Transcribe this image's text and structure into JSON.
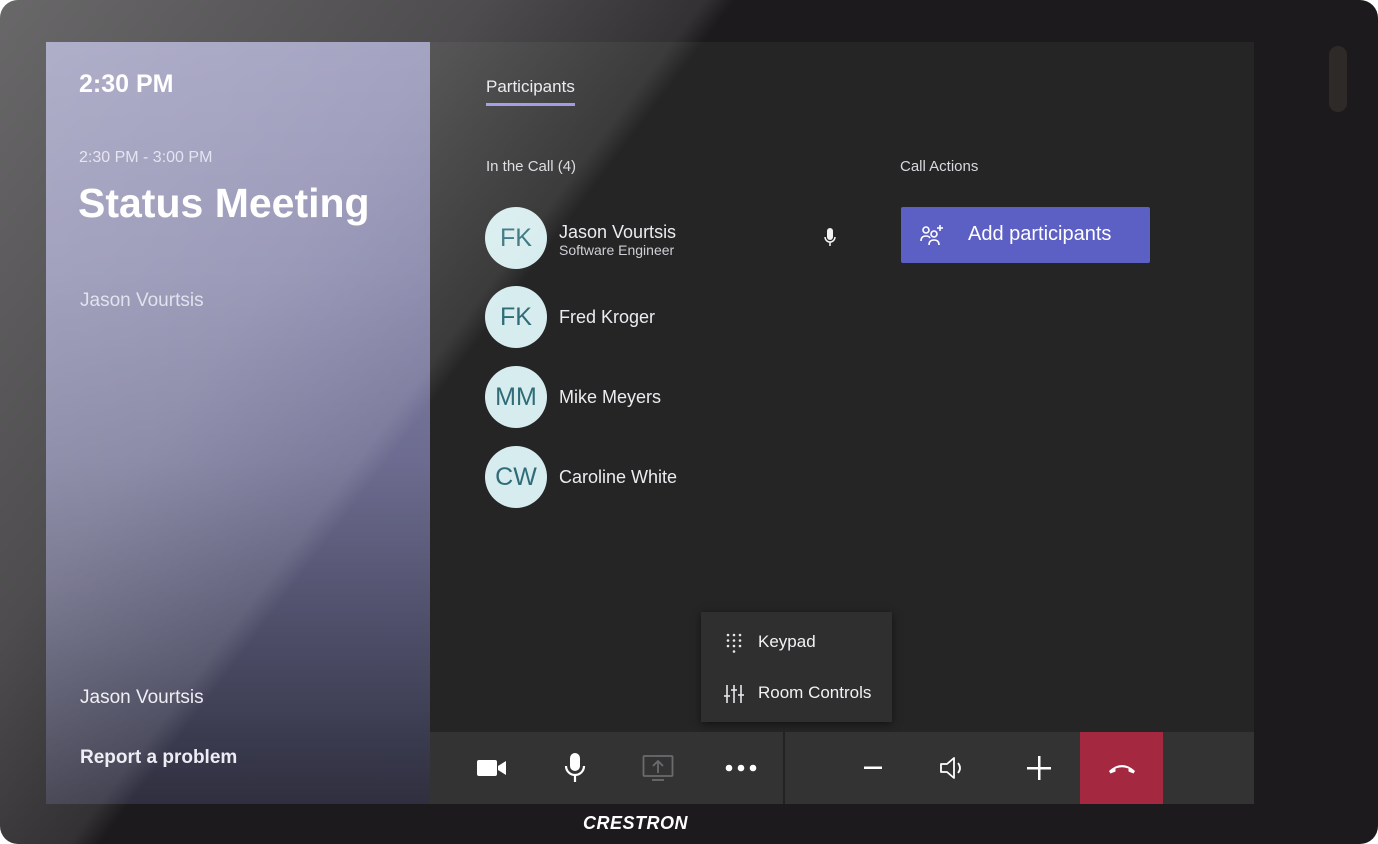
{
  "sidebar": {
    "time": "2:30 PM",
    "meeting_range": "2:30 PM - 3:00 PM",
    "meeting_title": "Status Meeting",
    "organizer": "Jason Vourtsis",
    "signed_in_user": "Jason Vourtsis",
    "report_problem": "Report a problem"
  },
  "main": {
    "tab_label": "Participants",
    "in_call_label": "In the Call (4)",
    "call_actions_label": "Call Actions",
    "participants": [
      {
        "initials": "FK",
        "name": "Jason Vourtsis",
        "role": "Software Engineer"
      },
      {
        "initials": "FK",
        "name": "Fred Kroger"
      },
      {
        "initials": "MM",
        "name": "Mike Meyers"
      },
      {
        "initials": "CW",
        "name": "Caroline White"
      }
    ],
    "add_participants_label": "Add participants",
    "accent_color": "#5c5fc4"
  },
  "more_menu": {
    "keypad_label": "Keypad",
    "room_controls_label": "Room Controls"
  },
  "toolbar": {
    "icons": [
      "camera-icon",
      "microphone-icon",
      "share-screen-icon",
      "more-icon",
      "volume-down-icon",
      "speaker-icon",
      "volume-up-icon",
      "hang-up-icon"
    ],
    "hangup_color": "#a4283f"
  },
  "device": {
    "brand": "CRESTRON"
  }
}
